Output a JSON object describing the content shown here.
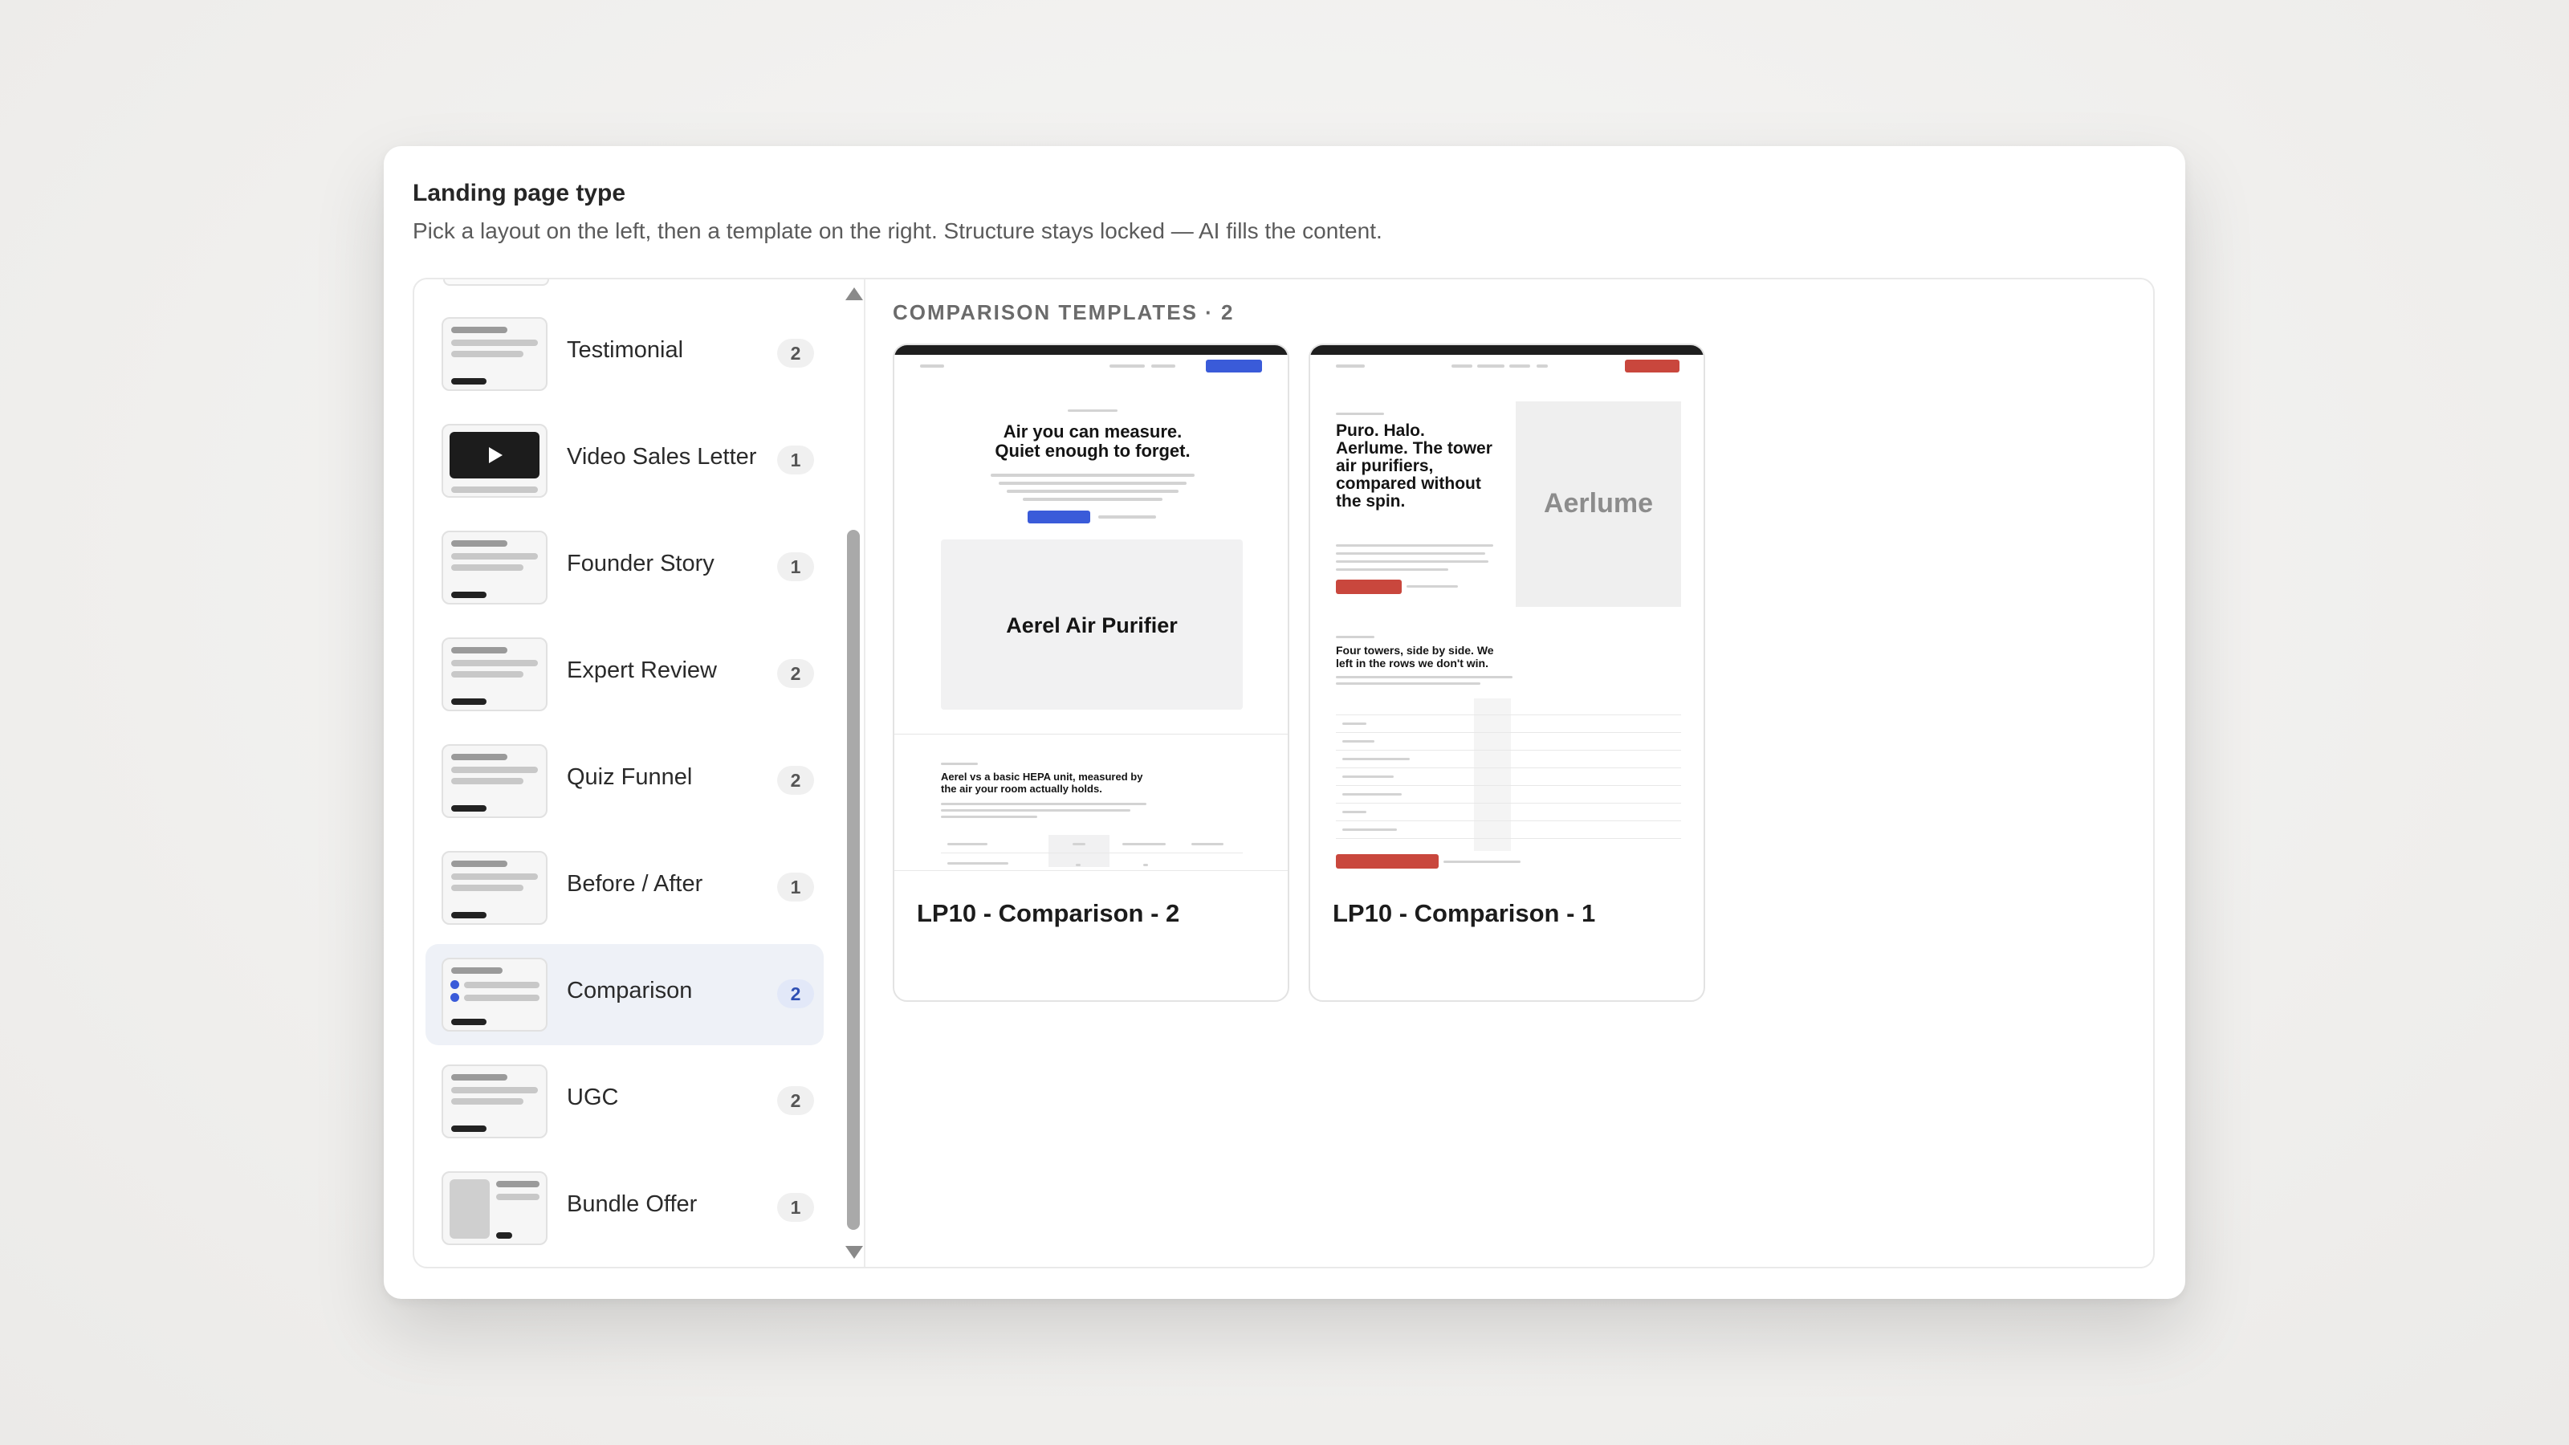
{
  "header": {
    "title": "Landing page type",
    "subtitle": "Pick a layout on the left, then a template on the right. Structure stays locked — AI fills the content."
  },
  "layouts": [
    {
      "label": "Testimonial",
      "count": "2"
    },
    {
      "label": "Video Sales Letter",
      "count": "1"
    },
    {
      "label": "Founder Story",
      "count": "1"
    },
    {
      "label": "Expert Review",
      "count": "2"
    },
    {
      "label": "Quiz Funnel",
      "count": "2"
    },
    {
      "label": "Before / After",
      "count": "1"
    },
    {
      "label": "Comparison",
      "count": "2"
    },
    {
      "label": "UGC",
      "count": "2"
    },
    {
      "label": "Bundle Offer",
      "count": "1"
    }
  ],
  "selected_layout": "Comparison",
  "templates": {
    "section_title": "COMPARISON TEMPLATES · 2",
    "items": [
      {
        "name": "LP10 - Comparison - 2",
        "preview_headline": "Air you can measure. Quiet enough to forget.",
        "preview_product": "Aerel Air Purifier",
        "preview_section": "Aerel vs a basic HEPA unit, measured by the air your room actually holds."
      },
      {
        "name": "LP10 - Comparison - 1",
        "preview_headline": "Puro. Halo. Aerlume. The tower air purifiers, compared without the spin.",
        "preview_brand": "Aerlume",
        "preview_section": "Four towers, side by side. We left in the rows we don't win."
      }
    ]
  },
  "colors": {
    "accent_blue": "#3a5bd9",
    "accent_red": "#c9473d",
    "selected_bg": "#eef1f7"
  }
}
